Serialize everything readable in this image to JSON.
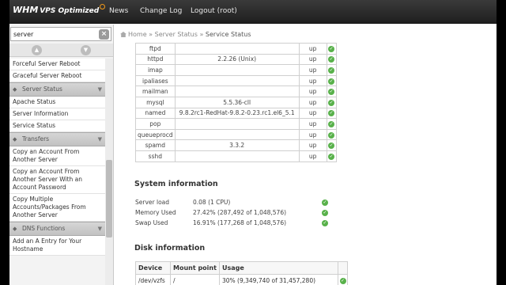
{
  "header": {
    "logo_brand": "WHM",
    "logo_sub": "VPS Optimized",
    "nav": [
      "News",
      "Change Log",
      "Logout (root)"
    ]
  },
  "sidebar": {
    "search_value": "server",
    "sections": [
      {
        "type": "item",
        "label": "Forceful Server Reboot"
      },
      {
        "type": "item",
        "label": "Graceful Server Reboot"
      },
      {
        "type": "head",
        "label": "Server Status"
      },
      {
        "type": "item",
        "label": "Apache Status"
      },
      {
        "type": "item",
        "label": "Server Information"
      },
      {
        "type": "item",
        "label": "Service Status"
      },
      {
        "type": "head",
        "label": "Transfers"
      },
      {
        "type": "item",
        "label": "Copy an Account From Another Server"
      },
      {
        "type": "item",
        "label": "Copy an Account From Another Server With an Account Password"
      },
      {
        "type": "item",
        "label": "Copy Multiple Accounts/Packages From Another Server"
      },
      {
        "type": "head",
        "label": "DNS Functions"
      },
      {
        "type": "item",
        "label": "Add an A Entry for Your Hostname"
      }
    ]
  },
  "breadcrumb": {
    "home": "Home",
    "sep": "»",
    "parent": "Server Status",
    "current": "Service Status"
  },
  "services": [
    {
      "name": "ftpd",
      "version": "",
      "status": "up"
    },
    {
      "name": "httpd",
      "version": "2.2.26 (Unix)",
      "status": "up"
    },
    {
      "name": "imap",
      "version": "",
      "status": "up"
    },
    {
      "name": "ipaliases",
      "version": "",
      "status": "up"
    },
    {
      "name": "mailman",
      "version": "",
      "status": "up"
    },
    {
      "name": "mysql",
      "version": "5.5.36-cll",
      "status": "up"
    },
    {
      "name": "named",
      "version": "9.8.2rc1-RedHat-9.8.2-0.23.rc1.el6_5.1",
      "status": "up"
    },
    {
      "name": "pop",
      "version": "",
      "status": "up"
    },
    {
      "name": "queueprocd",
      "version": "",
      "status": "up"
    },
    {
      "name": "spamd",
      "version": "3.3.2",
      "status": "up"
    },
    {
      "name": "sshd",
      "version": "",
      "status": "up"
    }
  ],
  "system": {
    "title": "System information",
    "rows": [
      {
        "label": "Server load",
        "value": "0.08 (1 CPU)"
      },
      {
        "label": "Memory Used",
        "value": "27.42% (287,492 of 1,048,576)"
      },
      {
        "label": "Swap Used",
        "value": "16.91% (177,268 of 1,048,576)"
      }
    ]
  },
  "disk": {
    "title": "Disk information",
    "headers": [
      "Device",
      "Mount point",
      "Usage"
    ],
    "rows": [
      {
        "device": "/dev/vzfs",
        "mount": "/",
        "usage": "30% (9,349,740 of 31,457,280)"
      }
    ]
  },
  "colors": {
    "ok": "#58b14a",
    "topbar": "#2b2b2b",
    "accent": "#f39a1a"
  },
  "icons": {
    "ok": "check-circle-icon",
    "search_clear": "close-icon",
    "home": "home-icon"
  }
}
